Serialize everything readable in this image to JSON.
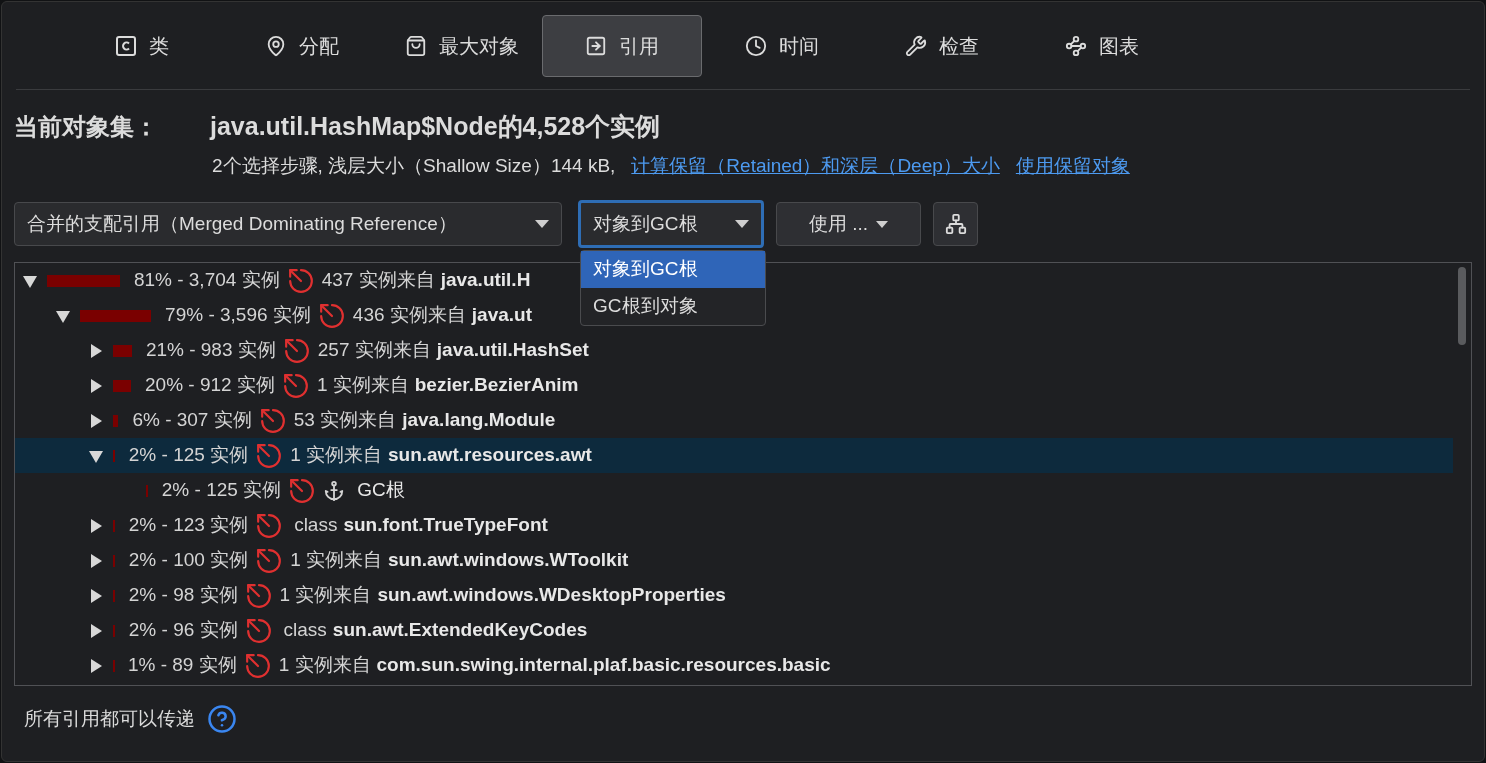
{
  "tabs": [
    {
      "kind": "class",
      "label": "类",
      "selected": false
    },
    {
      "kind": "allocation",
      "label": "分配",
      "selected": false
    },
    {
      "kind": "biggest",
      "label": "最大对象",
      "selected": false
    },
    {
      "kind": "references",
      "label": "引用",
      "selected": true
    },
    {
      "kind": "time",
      "label": "时间",
      "selected": false
    },
    {
      "kind": "inspect",
      "label": "检查",
      "selected": false
    },
    {
      "kind": "graph",
      "label": "图表",
      "selected": false
    }
  ],
  "header": {
    "label": "当前对象集：",
    "title": "java.util.HashMap$Node的4,528个实例",
    "info": "2个选择步骤, 浅层大小（Shallow Size）144 kB,",
    "links": [
      "计算保留（Retained）和深层（Deep）大小",
      "使用保留对象"
    ]
  },
  "toolbar": {
    "view_select": "合并的支配引用（Merged Dominating Reference）",
    "direction_select": "对象到GC根",
    "use_button": "使用 ...",
    "direction_menu": [
      {
        "label": "对象到GC根",
        "selected": true
      },
      {
        "label": "GC根到对象",
        "selected": false
      }
    ]
  },
  "tree": [
    {
      "percent": "81% - 3,704 实例",
      "kind": "from",
      "prefix": "437 实例来自",
      "target": "java.util.H",
      "expanded": true,
      "selected": false,
      "children": [
        {
          "percent": "79% - 3,596 实例",
          "kind": "from",
          "prefix": "436 实例来自",
          "target": "java.ut",
          "expanded": true,
          "selected": false,
          "children": [
            {
              "percent": "21% - 983 实例",
              "kind": "from",
              "prefix": "257 实例来自",
              "target": "java.util.HashSet",
              "expanded": false,
              "selected": false
            },
            {
              "percent": "20% - 912 实例",
              "kind": "from",
              "prefix": "1 实例来自",
              "target": "bezier.BezierAnim",
              "expanded": false,
              "selected": false
            },
            {
              "percent": "6% - 307 实例",
              "kind": "from",
              "prefix": "53 实例来自",
              "target": "java.lang.Module",
              "expanded": false,
              "selected": false
            },
            {
              "percent": "2% - 125 实例",
              "kind": "from",
              "prefix": "1 实例来自",
              "target": "sun.awt.resources.awt",
              "expanded": true,
              "selected": true,
              "children": [
                {
                  "percent": "2% - 125 实例",
                  "kind": "gcroot",
                  "target": "GC根",
                  "selected": false
                }
              ]
            },
            {
              "percent": "2% - 123 实例",
              "kind": "class",
              "prefix": "class",
              "target": "sun.font.TrueTypeFont",
              "expanded": false,
              "selected": false
            },
            {
              "percent": "2% - 100 实例",
              "kind": "from",
              "prefix": "1 实例来自",
              "target": "sun.awt.windows.WToolkit",
              "expanded": false,
              "selected": false
            },
            {
              "percent": "2% - 98 实例",
              "kind": "from",
              "prefix": "1 实例来自",
              "target": "sun.awt.windows.WDesktopProperties",
              "expanded": false,
              "selected": false
            },
            {
              "percent": "2% - 96 实例",
              "kind": "class",
              "prefix": "class",
              "target": "sun.awt.ExtendedKeyCodes",
              "expanded": false,
              "selected": false
            },
            {
              "percent": "1% - 89 实例",
              "kind": "from",
              "prefix": "1 实例来自",
              "target": "com.sun.swing.internal.plaf.basic.resources.basic",
              "expanded": false,
              "selected": false
            }
          ]
        }
      ]
    }
  ],
  "footer": {
    "text": "所有引用都可以传递"
  }
}
